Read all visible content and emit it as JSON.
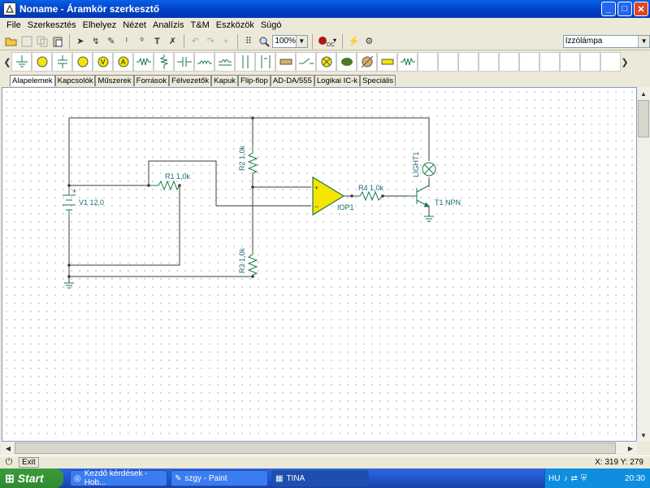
{
  "window": {
    "title": "Noname - Áramkör szerkesztő",
    "min": "_",
    "max": "□",
    "close": "✕"
  },
  "menu": [
    "File",
    "Szerkesztés",
    "Elhelyez",
    "Nézet",
    "Analízis",
    "T&M",
    "Eszközök",
    "Súgó"
  ],
  "toolbar": {
    "zoom": "100%",
    "component_select": "Izzólámpa",
    "dc_label": "DC"
  },
  "tabs": [
    "Alapelemek",
    "Kapcsolók",
    "Műszerek",
    "Források",
    "Félvezetők",
    "Kapuk",
    "Flip-flop",
    "AD-DA/555",
    "Logikai IC-k",
    "Speciális"
  ],
  "active_tab": 0,
  "circuit": {
    "V1": "V1 12,0",
    "R1": "R1 1,0k",
    "R2": "R2 1,0k",
    "R3": "R3 1,0k",
    "R4": "R4 1,0k",
    "IOP1": "IOP1",
    "T1": "T1 NPN",
    "LIGHT1": "LIGHT1",
    "plus": "+"
  },
  "status": {
    "exit": "Exit",
    "coords": "X: 319  Y: 279"
  },
  "taskbar": {
    "start": "Start",
    "tasks": [
      "Kezdő kérdések - Hob...",
      "szgy - Paint",
      "TINA"
    ],
    "active_task": 2,
    "lang": "HU",
    "clock": "20:30"
  },
  "colors": {
    "wire": "#3c3c3c",
    "component": "#1a7a4a",
    "opamp_fill": "#f5e600",
    "label": "#1a6a7a"
  }
}
